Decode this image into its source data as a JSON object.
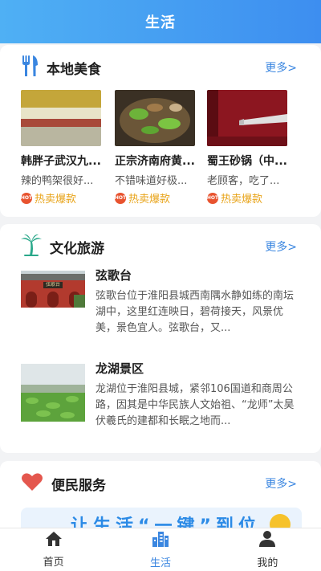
{
  "header": {
    "title": "生活"
  },
  "food": {
    "title": "本地美食",
    "more": "更多>",
    "items": [
      {
        "name": "韩胖子武汉九...",
        "desc": "辣的鸭架很好...",
        "tag": "热卖爆款",
        "badge": "HOT"
      },
      {
        "name": "正宗济南府黄...",
        "desc": "不错味道好极...",
        "tag": "热卖爆款",
        "badge": "HOT"
      },
      {
        "name": "蜀王砂锅（中...",
        "desc": "老顾客，吃了...",
        "tag": "热卖爆款",
        "badge": "HOT"
      }
    ]
  },
  "tourism": {
    "title": "文化旅游",
    "more": "更多>",
    "items": [
      {
        "title": "弦歌台",
        "desc": "弦歌台位于淮阳县城西南隅水静如练的南坛湖中，这里红连映日，碧荷接天，风景优美，景色宜人。弦歌台，又...",
        "img_sign": "弦歌台"
      },
      {
        "title": "龙湖景区",
        "desc": "龙湖位于淮阳县城，紧邻106国道和商周公路，因其是中华民族人文始祖、“龙师”太昊伏羲氏的建都和长眠之地而..."
      }
    ]
  },
  "services": {
    "title": "便民服务",
    "more": "更多>",
    "banner_text": "让生活“一键”到位"
  },
  "tabbar": {
    "items": [
      {
        "label": "首页",
        "icon": "home-icon",
        "active": false
      },
      {
        "label": "生活",
        "icon": "city-icon",
        "active": true
      },
      {
        "label": "我的",
        "icon": "user-icon",
        "active": false
      }
    ]
  },
  "colors": {
    "accent": "#3a86e0",
    "header_start": "#4fb0f4",
    "header_end": "#3d8ef0",
    "hot_tag": "#e8a318"
  }
}
